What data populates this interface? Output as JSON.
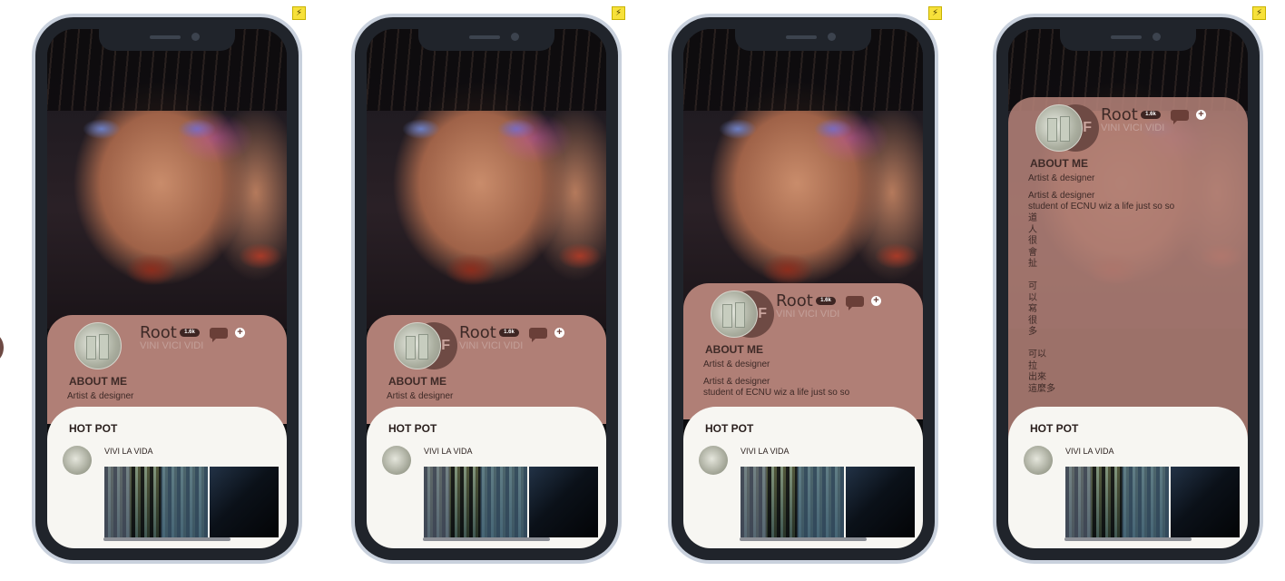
{
  "profile": {
    "name": "Root",
    "followers": "1.6k",
    "subtitle": "VINI VICI VIDI",
    "avatar_initial": "F",
    "about_title": "ABOUT ME",
    "role": "Artist & designer",
    "bio_line": "student of ECNU wiz a life just so so",
    "bio_long": "道\n人\n很\n會\n扯\n\n可\n以\n寫\n很\n多\n\n可以\n拉\n出來\n這麼多"
  },
  "hot_pot": {
    "title": "HOT POT",
    "post_title": "VIVI LA VIDA"
  },
  "icons": [
    "bolt-icon",
    "message-icon",
    "plus-icon"
  ],
  "colors": {
    "card": "#b07f76",
    "hot_bg": "#f7f6f2",
    "frame": "#c9d1dd"
  }
}
